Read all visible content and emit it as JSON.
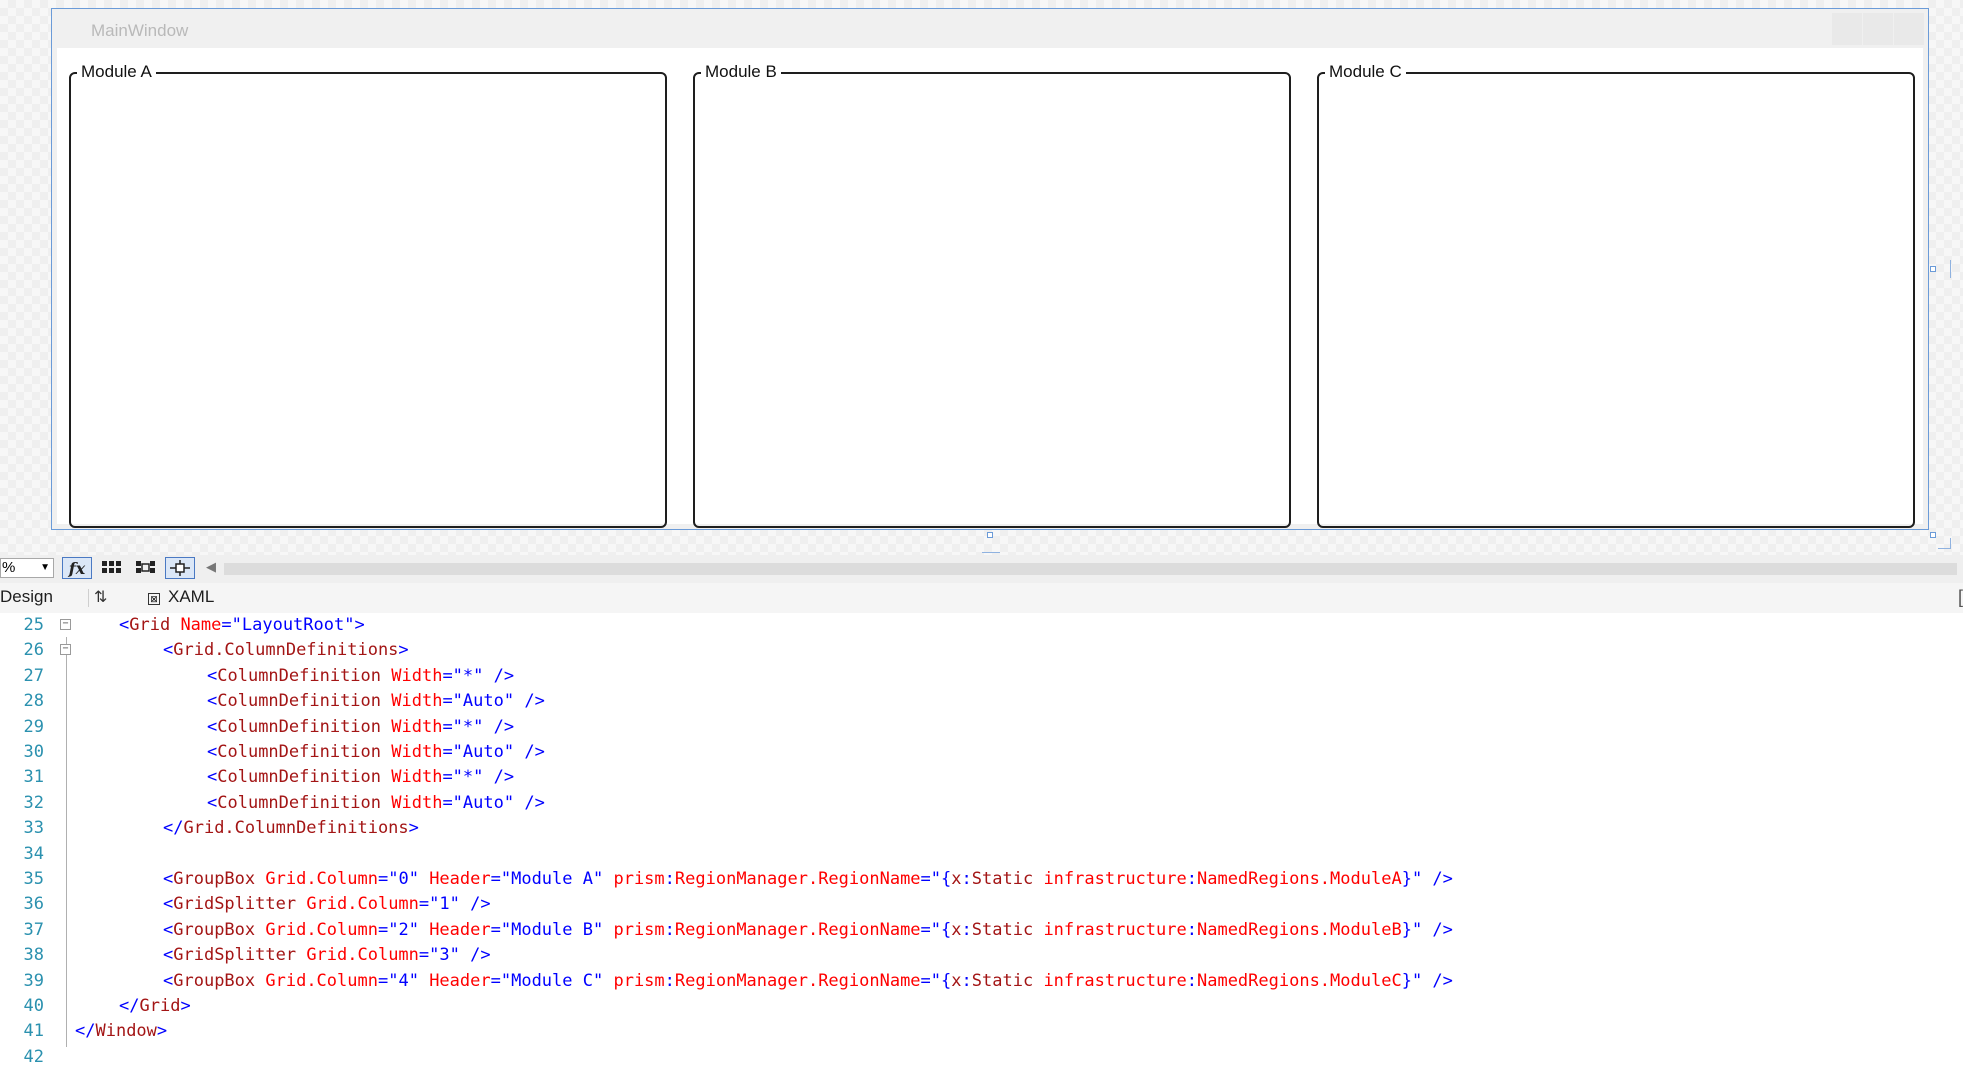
{
  "designer": {
    "window_title": "MainWindow",
    "group_boxes": [
      "Module A",
      "Module B",
      "Module C"
    ]
  },
  "toolbar": {
    "zoom_value": "%",
    "fx_label": "fx"
  },
  "tabs": {
    "design": "Design",
    "xaml": "XAML"
  },
  "code_lines": [
    {
      "n": "25",
      "indent": 1,
      "tokens": [
        [
          "b",
          "<"
        ],
        [
          "tg",
          "Grid"
        ],
        [
          "at",
          " Name"
        ],
        [
          "b",
          "=\""
        ],
        [
          "vl",
          "LayoutRoot"
        ],
        [
          "b",
          "\">"
        ]
      ]
    },
    {
      "n": "26",
      "indent": 2,
      "tokens": [
        [
          "b",
          "<"
        ],
        [
          "tg",
          "Grid.ColumnDefinitions"
        ],
        [
          "b",
          ">"
        ]
      ]
    },
    {
      "n": "27",
      "indent": 3,
      "tokens": [
        [
          "b",
          "<"
        ],
        [
          "tg",
          "ColumnDefinition"
        ],
        [
          "at",
          " Width"
        ],
        [
          "b",
          "=\""
        ],
        [
          "vl",
          "*"
        ],
        [
          "b",
          "\" />"
        ]
      ]
    },
    {
      "n": "28",
      "indent": 3,
      "tokens": [
        [
          "b",
          "<"
        ],
        [
          "tg",
          "ColumnDefinition"
        ],
        [
          "at",
          " Width"
        ],
        [
          "b",
          "=\""
        ],
        [
          "vl",
          "Auto"
        ],
        [
          "b",
          "\" />"
        ]
      ]
    },
    {
      "n": "29",
      "indent": 3,
      "tokens": [
        [
          "b",
          "<"
        ],
        [
          "tg",
          "ColumnDefinition"
        ],
        [
          "at",
          " Width"
        ],
        [
          "b",
          "=\""
        ],
        [
          "vl",
          "*"
        ],
        [
          "b",
          "\" />"
        ]
      ]
    },
    {
      "n": "30",
      "indent": 3,
      "tokens": [
        [
          "b",
          "<"
        ],
        [
          "tg",
          "ColumnDefinition"
        ],
        [
          "at",
          " Width"
        ],
        [
          "b",
          "=\""
        ],
        [
          "vl",
          "Auto"
        ],
        [
          "b",
          "\" />"
        ]
      ]
    },
    {
      "n": "31",
      "indent": 3,
      "tokens": [
        [
          "b",
          "<"
        ],
        [
          "tg",
          "ColumnDefinition"
        ],
        [
          "at",
          " Width"
        ],
        [
          "b",
          "=\""
        ],
        [
          "vl",
          "*"
        ],
        [
          "b",
          "\" />"
        ]
      ]
    },
    {
      "n": "32",
      "indent": 3,
      "tokens": [
        [
          "b",
          "<"
        ],
        [
          "tg",
          "ColumnDefinition"
        ],
        [
          "at",
          " Width"
        ],
        [
          "b",
          "=\""
        ],
        [
          "vl",
          "Auto"
        ],
        [
          "b",
          "\" />"
        ]
      ]
    },
    {
      "n": "33",
      "indent": 2,
      "tokens": [
        [
          "b",
          "</"
        ],
        [
          "tg",
          "Grid.ColumnDefinitions"
        ],
        [
          "b",
          ">"
        ]
      ]
    },
    {
      "n": "34",
      "indent": 0,
      "tokens": []
    },
    {
      "n": "35",
      "indent": 2,
      "tokens": [
        [
          "b",
          "<"
        ],
        [
          "tg",
          "GroupBox"
        ],
        [
          "at",
          " Grid.Column"
        ],
        [
          "b",
          "=\""
        ],
        [
          "vl",
          "0"
        ],
        [
          "b",
          "\""
        ],
        [
          "at",
          " Header"
        ],
        [
          "b",
          "=\""
        ],
        [
          "vl",
          "Module A"
        ],
        [
          "b",
          "\""
        ],
        [
          "at",
          " prism"
        ],
        [
          "b",
          ":"
        ],
        [
          "at",
          "RegionManager.RegionName"
        ],
        [
          "b",
          "=\""
        ],
        [
          "vl",
          "{"
        ],
        [
          "tg",
          "x"
        ],
        [
          "vl",
          ":"
        ],
        [
          "tg",
          "Static"
        ],
        [
          "at",
          " infrastructure"
        ],
        [
          "vl",
          ":"
        ],
        [
          "at",
          "NamedRegions.ModuleA"
        ],
        [
          "vl",
          "}"
        ],
        [
          "b",
          "\" />"
        ]
      ]
    },
    {
      "n": "36",
      "indent": 2,
      "tokens": [
        [
          "b",
          "<"
        ],
        [
          "tg",
          "GridSplitter"
        ],
        [
          "at",
          " Grid.Column"
        ],
        [
          "b",
          "=\""
        ],
        [
          "vl",
          "1"
        ],
        [
          "b",
          "\" />"
        ]
      ]
    },
    {
      "n": "37",
      "indent": 2,
      "tokens": [
        [
          "b",
          "<"
        ],
        [
          "tg",
          "GroupBox"
        ],
        [
          "at",
          " Grid.Column"
        ],
        [
          "b",
          "=\""
        ],
        [
          "vl",
          "2"
        ],
        [
          "b",
          "\""
        ],
        [
          "at",
          " Header"
        ],
        [
          "b",
          "=\""
        ],
        [
          "vl",
          "Module B"
        ],
        [
          "b",
          "\""
        ],
        [
          "at",
          " prism"
        ],
        [
          "b",
          ":"
        ],
        [
          "at",
          "RegionManager.RegionName"
        ],
        [
          "b",
          "=\""
        ],
        [
          "vl",
          "{"
        ],
        [
          "tg",
          "x"
        ],
        [
          "vl",
          ":"
        ],
        [
          "tg",
          "Static"
        ],
        [
          "at",
          " infrastructure"
        ],
        [
          "vl",
          ":"
        ],
        [
          "at",
          "NamedRegions.ModuleB"
        ],
        [
          "vl",
          "}"
        ],
        [
          "b",
          "\" />"
        ]
      ]
    },
    {
      "n": "38",
      "indent": 2,
      "tokens": [
        [
          "b",
          "<"
        ],
        [
          "tg",
          "GridSplitter"
        ],
        [
          "at",
          " Grid.Column"
        ],
        [
          "b",
          "=\""
        ],
        [
          "vl",
          "3"
        ],
        [
          "b",
          "\" />"
        ]
      ]
    },
    {
      "n": "39",
      "indent": 2,
      "tokens": [
        [
          "b",
          "<"
        ],
        [
          "tg",
          "GroupBox"
        ],
        [
          "at",
          " Grid.Column"
        ],
        [
          "b",
          "=\""
        ],
        [
          "vl",
          "4"
        ],
        [
          "b",
          "\""
        ],
        [
          "at",
          " Header"
        ],
        [
          "b",
          "=\""
        ],
        [
          "vl",
          "Module C"
        ],
        [
          "b",
          "\""
        ],
        [
          "at",
          " prism"
        ],
        [
          "b",
          ":"
        ],
        [
          "at",
          "RegionManager.RegionName"
        ],
        [
          "b",
          "=\""
        ],
        [
          "vl",
          "{"
        ],
        [
          "tg",
          "x"
        ],
        [
          "vl",
          ":"
        ],
        [
          "tg",
          "Static"
        ],
        [
          "at",
          " infrastructure"
        ],
        [
          "vl",
          ":"
        ],
        [
          "at",
          "NamedRegions.ModuleC"
        ],
        [
          "vl",
          "}"
        ],
        [
          "b",
          "\" />"
        ]
      ]
    },
    {
      "n": "40",
      "indent": 1,
      "tokens": [
        [
          "b",
          "</"
        ],
        [
          "tg",
          "Grid"
        ],
        [
          "b",
          ">"
        ]
      ]
    },
    {
      "n": "41",
      "indent": 0,
      "tokens": [
        [
          "b",
          "</"
        ],
        [
          "tg",
          "Window"
        ],
        [
          "b",
          ">"
        ]
      ]
    },
    {
      "n": "42",
      "indent": 0,
      "tokens": []
    }
  ]
}
